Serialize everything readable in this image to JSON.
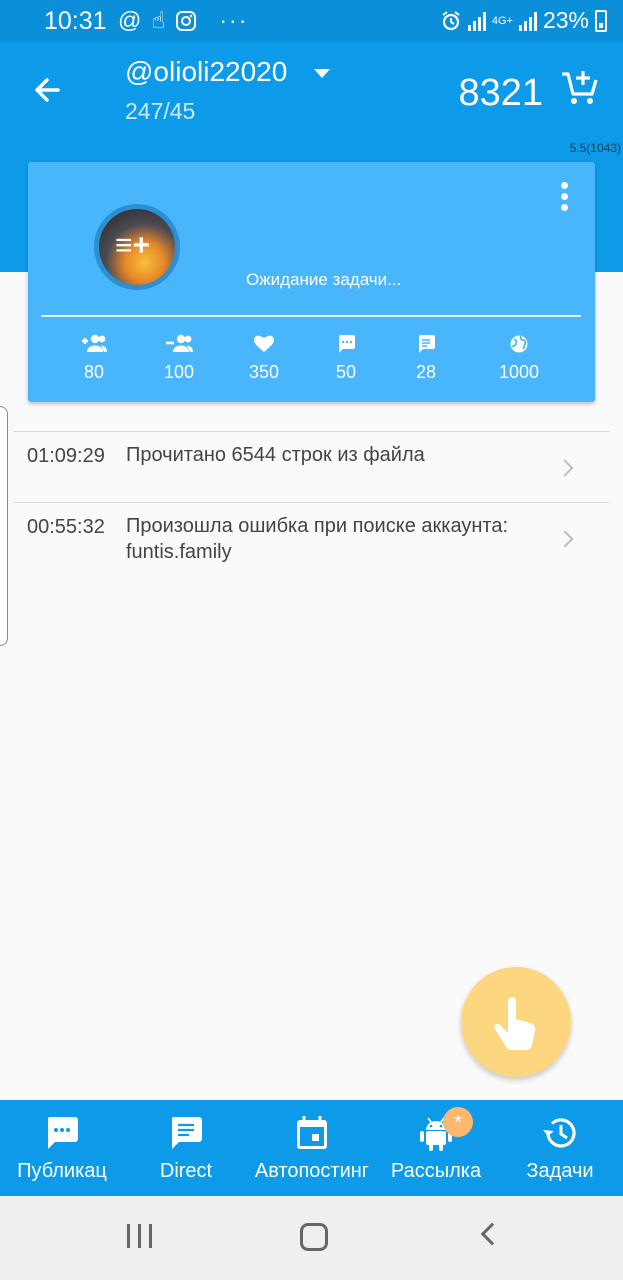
{
  "status_bar": {
    "time": "10:31",
    "left_icons": [
      "at-icon",
      "touch-icon",
      "instagram-icon",
      "more-icon"
    ],
    "network": "4G+",
    "battery": "23%"
  },
  "header": {
    "account": "@olioli22020",
    "counts": "247/45",
    "credits": "8321"
  },
  "version": "5.5(1043)",
  "card": {
    "status": "Ожидание задачи...",
    "stats": [
      {
        "icon": "follow-icon",
        "value": "80"
      },
      {
        "icon": "unfollow-icon",
        "value": "100"
      },
      {
        "icon": "like-icon",
        "value": "350"
      },
      {
        "icon": "comment-icon",
        "value": "50"
      },
      {
        "icon": "direct-message-icon",
        "value": "28"
      },
      {
        "icon": "globe-icon",
        "value": "1000"
      }
    ]
  },
  "log": [
    {
      "time": "01:09:29",
      "message": "Прочитано 6544 строк из файла"
    },
    {
      "time": "00:55:32",
      "message": "Произошла ошибка при поиске аккаунта: funtis.family"
    }
  ],
  "bottom_nav": {
    "items": [
      {
        "label": "Публикац",
        "icon": "chat-icon"
      },
      {
        "label": "Direct",
        "icon": "message-icon"
      },
      {
        "label": "Автопостинг",
        "icon": "calendar-icon"
      },
      {
        "label": "Рассылка",
        "icon": "android-icon",
        "badge": "*"
      },
      {
        "label": "Задачи",
        "icon": "history-icon"
      }
    ]
  },
  "colors": {
    "primary": "#0d9be9",
    "card": "#49b5fa",
    "fab": "#fdd77f",
    "badge": "#fbb86e"
  }
}
